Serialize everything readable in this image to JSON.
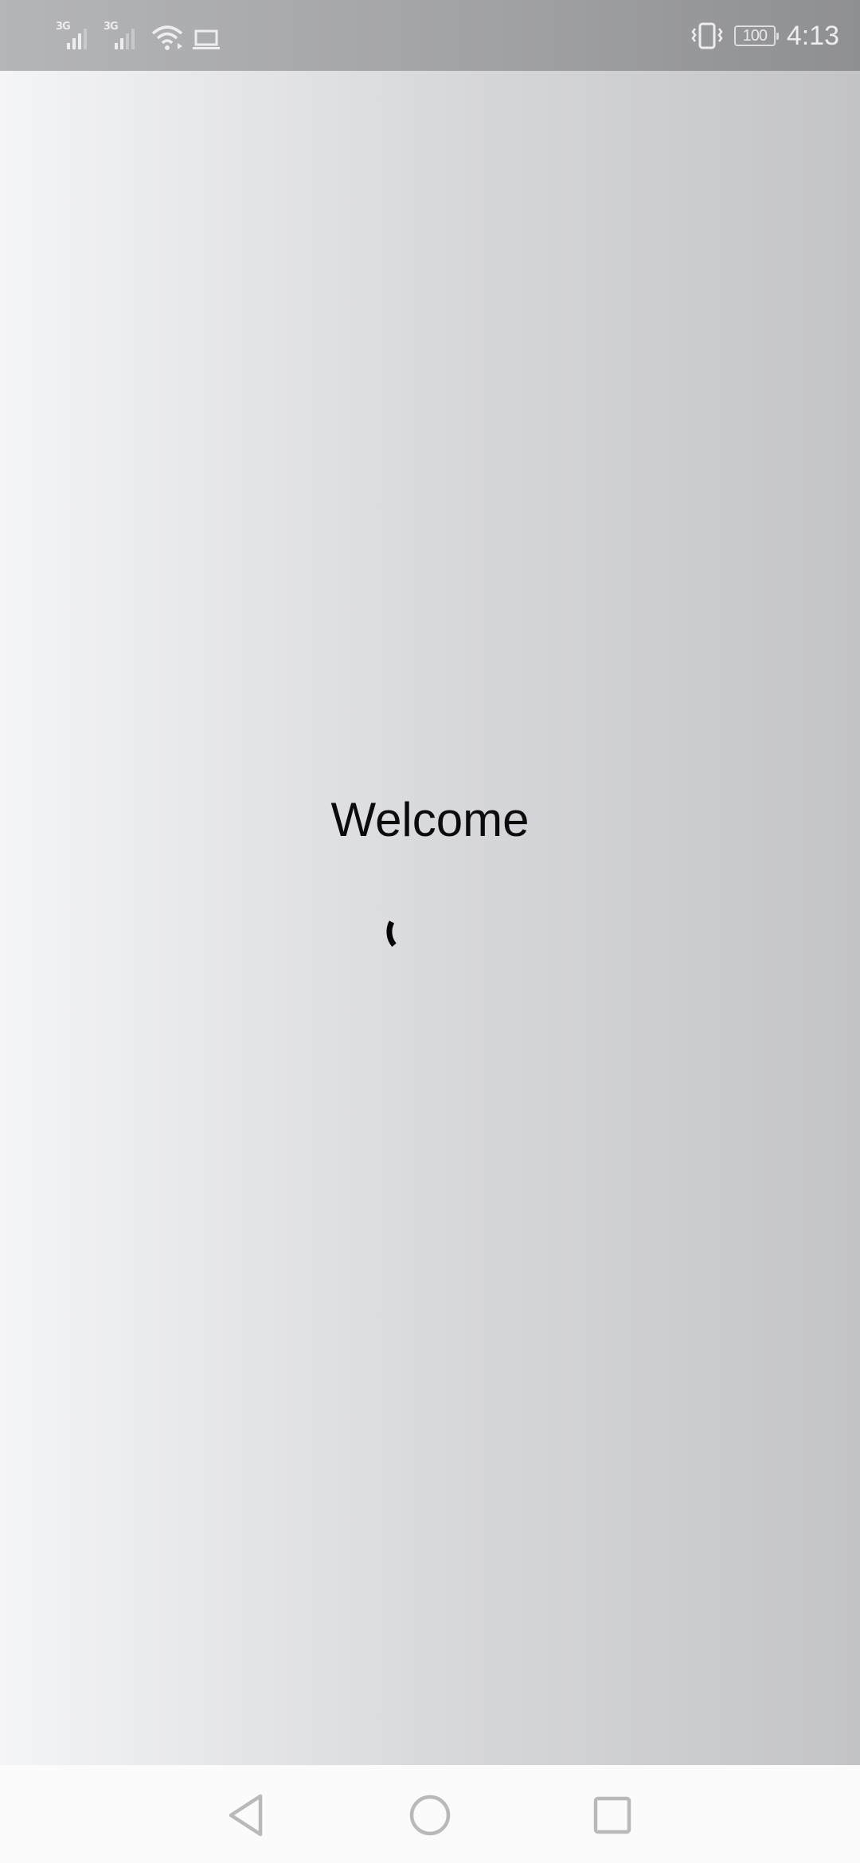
{
  "status_bar": {
    "sim1_network": "3G",
    "sim2_network": "3G",
    "battery_level": "100",
    "time": "4:13",
    "icons": [
      "signal-icon",
      "signal-icon",
      "wifi-icon",
      "laptop-icon",
      "vibrate-icon",
      "battery-icon"
    ]
  },
  "main": {
    "welcome_text": "Welcome"
  },
  "nav_bar": {
    "buttons": [
      "back",
      "home",
      "recents"
    ]
  },
  "colors": {
    "status_bar_bg": "#a0a1a4",
    "background_left": "#f4f5f9",
    "background_right": "#c3c4c8",
    "nav_icon": "#b9b9bb",
    "text": "#0b0b0c"
  }
}
